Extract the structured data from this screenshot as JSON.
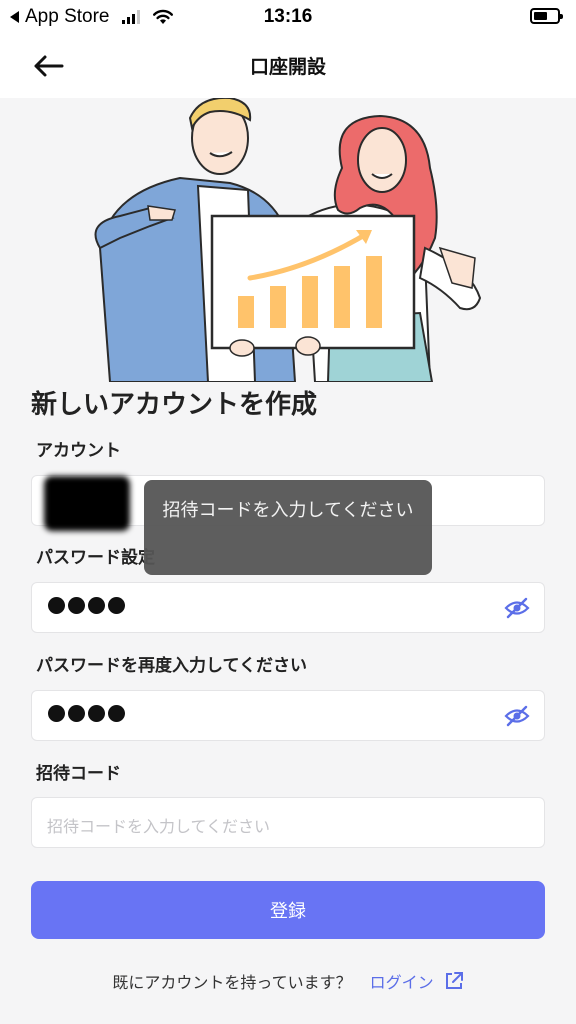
{
  "status_bar": {
    "back_app": "App Store",
    "time": "13:16"
  },
  "nav": {
    "title": "口座開設"
  },
  "form": {
    "heading": "新しいアカウントを作成",
    "account_label": "アカウント",
    "password_label": "パスワード設定",
    "password_confirm_label": "パスワードを再度入力してください",
    "invite_label": "招待コード",
    "invite_placeholder": "招待コードを入力してください",
    "submit_label": "登録"
  },
  "toast": {
    "message": "招待コードを入力してください"
  },
  "footer": {
    "question": "既にアカウントを持っています？",
    "login_label": "ログイン"
  },
  "colors": {
    "accent": "#6874f4",
    "link": "#5b6ee8",
    "background": "#f5f5f6"
  }
}
